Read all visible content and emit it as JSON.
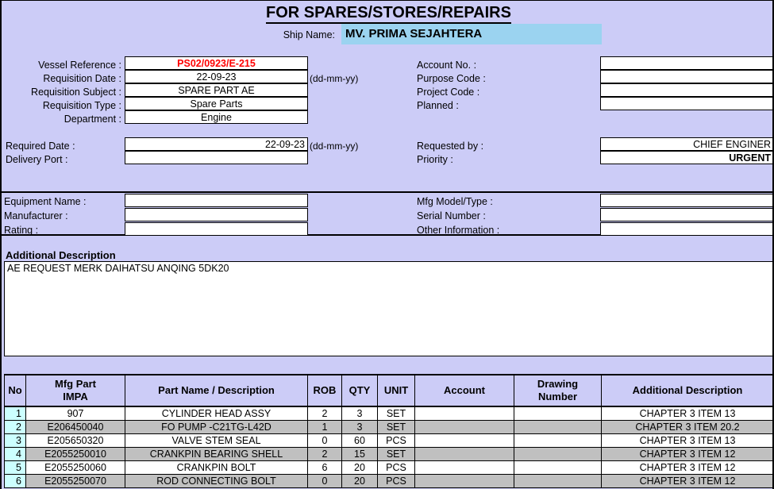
{
  "document": {
    "title": "FOR SPARES/STORES/REPAIRS",
    "ship_name_label": "Ship Name:",
    "ship_name_value": "MV. PRIMA SEJAHTERA",
    "highlight_color": "#9BD3F0",
    "background_color": "#CCCCF7",
    "accent_color": "#FF0000"
  },
  "requisition": {
    "vessel_reference_label": "Vessel Reference :",
    "vessel_reference_value": "PS02/0923/E-215",
    "requisition_date_label": "Requisition Date :",
    "requisition_date_value": "22-09-23",
    "requisition_date_hint": "(dd-mm-yy)",
    "requisition_subject_label": "Requisition Subject :",
    "requisition_subject_value": "SPARE PART  AE",
    "requisition_type_label": "Requisition Type  :",
    "requisition_type_value": "Spare Parts",
    "department_label": "Department  :",
    "department_value": "Engine"
  },
  "codes": {
    "account_no_label": "Account No.  :",
    "account_no_value": "",
    "purpose_code_label": "Purpose Code  :",
    "purpose_code_value": "",
    "project_code_label": "Project Code  :",
    "project_code_value": "",
    "planned_label": "Planned :",
    "planned_value": ""
  },
  "delivery": {
    "required_date_label": "Required Date :",
    "required_date_value": "22-09-23",
    "required_date_hint": "(dd-mm-yy)",
    "delivery_port_label": "Delivery Port :",
    "delivery_port_value": ""
  },
  "request": {
    "requested_by_label": "Requested by :",
    "requested_by_value": "CHIEF ENGINER",
    "priority_label": "Priority :",
    "priority_value": "URGENT"
  },
  "equipment": {
    "equipment_name_label": "Equipment Name :",
    "equipment_name_value": "",
    "manufacturer_label": "Manufacturer :",
    "manufacturer_value": "",
    "rating_label": "Rating :",
    "rating_value": "",
    "mfg_model_label": "Mfg Model/Type :",
    "mfg_model_value": "",
    "serial_number_label": "Serial Number :",
    "serial_number_value": "",
    "other_information_label": "Other Information :",
    "other_information_value": ""
  },
  "additional_description": {
    "heading": "Additional Description",
    "text": "AE REQUEST  MERK DAIHATSU ANQING 5DK20"
  },
  "parts_table": {
    "columns": [
      "No",
      "Mfg Part\nIMPA",
      "Part Name / Description",
      "ROB",
      "QTY",
      "UNIT",
      "Account",
      "Drawing\nNumber",
      "Additional Description"
    ],
    "header_mfg_line1": "Mfg Part",
    "header_mfg_line2": "IMPA",
    "header_drawing_line1": "Drawing",
    "header_drawing_line2": "Number",
    "rows": [
      {
        "no": "1",
        "mfg_part": "907",
        "part_name": "CYLINDER HEAD ASSY",
        "rob": "2",
        "qty": "3",
        "unit": "SET",
        "account": "",
        "drawing_number": "",
        "additional_description": "CHAPTER 3 ITEM 13"
      },
      {
        "no": "2",
        "mfg_part": "E206450040",
        "part_name": "FO PUMP -C21TG-L42D",
        "rob": "1",
        "qty": "3",
        "unit": "SET",
        "account": "",
        "drawing_number": "",
        "additional_description": "CHAPTER 3 ITEM 20.2"
      },
      {
        "no": "3",
        "mfg_part": "E205650320",
        "part_name": "VALVE STEM SEAL",
        "rob": "0",
        "qty": "60",
        "unit": "PCS",
        "account": "",
        "drawing_number": "",
        "additional_description": "CHAPTER 3 ITEM 13"
      },
      {
        "no": "4",
        "mfg_part": "E2055250010",
        "part_name": "CRANKPIN BEARING SHELL",
        "rob": "2",
        "qty": "15",
        "unit": "SET",
        "account": "",
        "drawing_number": "",
        "additional_description": "CHAPTER 3 ITEM 12"
      },
      {
        "no": "5",
        "mfg_part": "E2055250060",
        "part_name": "CRANKPIN BOLT",
        "rob": "6",
        "qty": "20",
        "unit": "PCS",
        "account": "",
        "drawing_number": "",
        "additional_description": "CHAPTER 3 ITEM 12"
      },
      {
        "no": "6",
        "mfg_part": "E2055250070",
        "part_name": "ROD CONNECTING BOLT",
        "rob": "0",
        "qty": "20",
        "unit": "PCS",
        "account": "",
        "drawing_number": "",
        "additional_description": "CHAPTER 3 ITEM 12"
      }
    ]
  }
}
